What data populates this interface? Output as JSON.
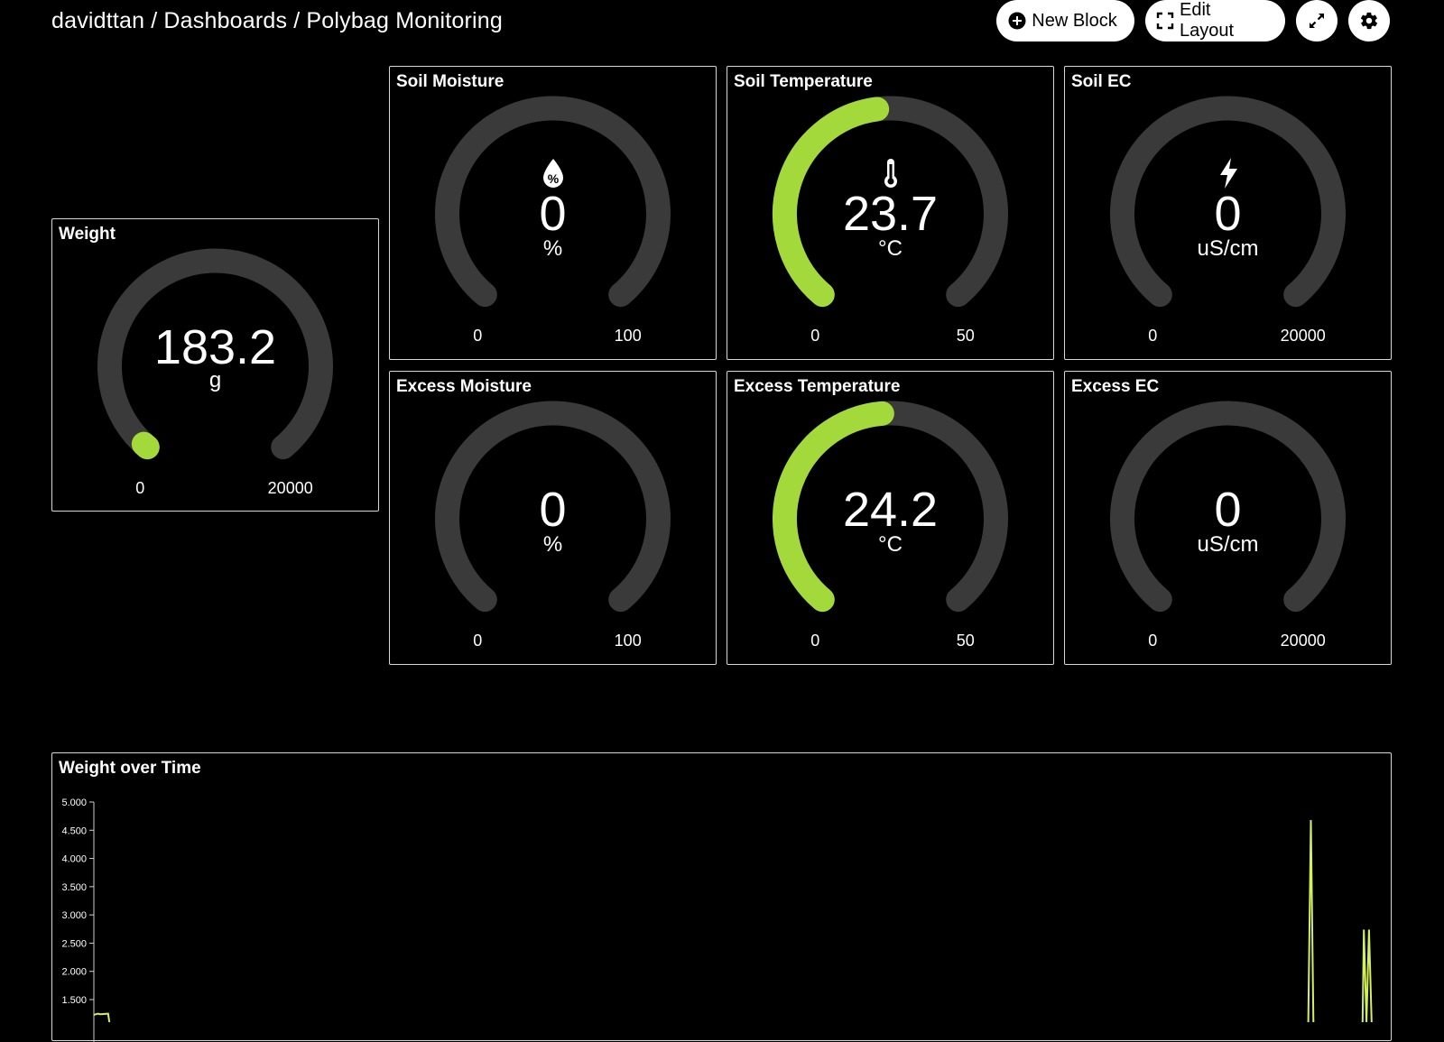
{
  "breadcrumb": {
    "user": "davidttan",
    "section": "Dashboards",
    "page": "Polybag Monitoring",
    "separator": "/"
  },
  "toolbar": {
    "new_block_label": "New Block",
    "edit_layout_label": "Edit Layout",
    "fullscreen_icon": "expand-arrows-icon",
    "settings_icon": "gear-icon"
  },
  "colors": {
    "accent": "#a3d93a",
    "track": "#3a3a3a",
    "background": "#000000",
    "border": "#d8d8d8",
    "line": "#d4f05a"
  },
  "gauges": {
    "weight": {
      "title": "Weight",
      "value": "183.2",
      "numeric": 183.2,
      "unit": "g",
      "min": "0",
      "max": "20000",
      "min_num": 0,
      "max_num": 20000,
      "icon": ""
    },
    "soil_moisture": {
      "title": "Soil Moisture",
      "value": "0",
      "numeric": 0,
      "unit": "%",
      "min": "0",
      "max": "100",
      "min_num": 0,
      "max_num": 100,
      "icon": "droplet-percent-icon"
    },
    "soil_temp": {
      "title": "Soil Temperature",
      "value": "23.7",
      "numeric": 23.7,
      "unit": "°C",
      "min": "0",
      "max": "50",
      "min_num": 0,
      "max_num": 50,
      "icon": "thermometer-icon"
    },
    "soil_ec": {
      "title": "Soil EC",
      "value": "0",
      "numeric": 0,
      "unit": "uS/cm",
      "min": "0",
      "max": "20000",
      "min_num": 0,
      "max_num": 20000,
      "icon": "lightning-icon"
    },
    "excess_moisture": {
      "title": "Excess Moisture",
      "value": "0",
      "numeric": 0,
      "unit": "%",
      "min": "0",
      "max": "100",
      "min_num": 0,
      "max_num": 100,
      "icon": ""
    },
    "excess_temp": {
      "title": "Excess Temperature",
      "value": "24.2",
      "numeric": 24.2,
      "unit": "°C",
      "min": "0",
      "max": "50",
      "min_num": 0,
      "max_num": 50,
      "icon": ""
    },
    "excess_ec": {
      "title": "Excess EC",
      "value": "0",
      "numeric": 0,
      "unit": "uS/cm",
      "min": "0",
      "max": "20000",
      "min_num": 0,
      "max_num": 20000,
      "icon": ""
    }
  },
  "chart": {
    "title": "Weight over Time"
  },
  "chart_data": {
    "type": "line",
    "title": "Weight over Time",
    "xlabel": "",
    "ylabel": "",
    "ylim": [
      1100,
      5000
    ],
    "yticks": [
      "1.500",
      "2.000",
      "2.500",
      "3.000",
      "3.500",
      "4.000",
      "4.500",
      "5.000"
    ],
    "ytick_values": [
      1500,
      2000,
      2500,
      3000,
      3500,
      4000,
      4500,
      5000
    ],
    "xlim": [
      0,
      1
    ],
    "grid": false,
    "series": [
      {
        "x": [
          0.0,
          0.003,
          0.005,
          0.011,
          0.012
        ],
        "y": [
          1230,
          1250,
          1240,
          1250,
          1100
        ]
      },
      {
        "x": [
          0.939,
          0.941,
          0.943
        ],
        "y": [
          1100,
          4680,
          1100
        ]
      },
      {
        "x": [
          0.981,
          0.982,
          0.984,
          0.986,
          0.988
        ],
        "y": [
          1100,
          2740,
          1100,
          2740,
          1100
        ]
      }
    ]
  }
}
